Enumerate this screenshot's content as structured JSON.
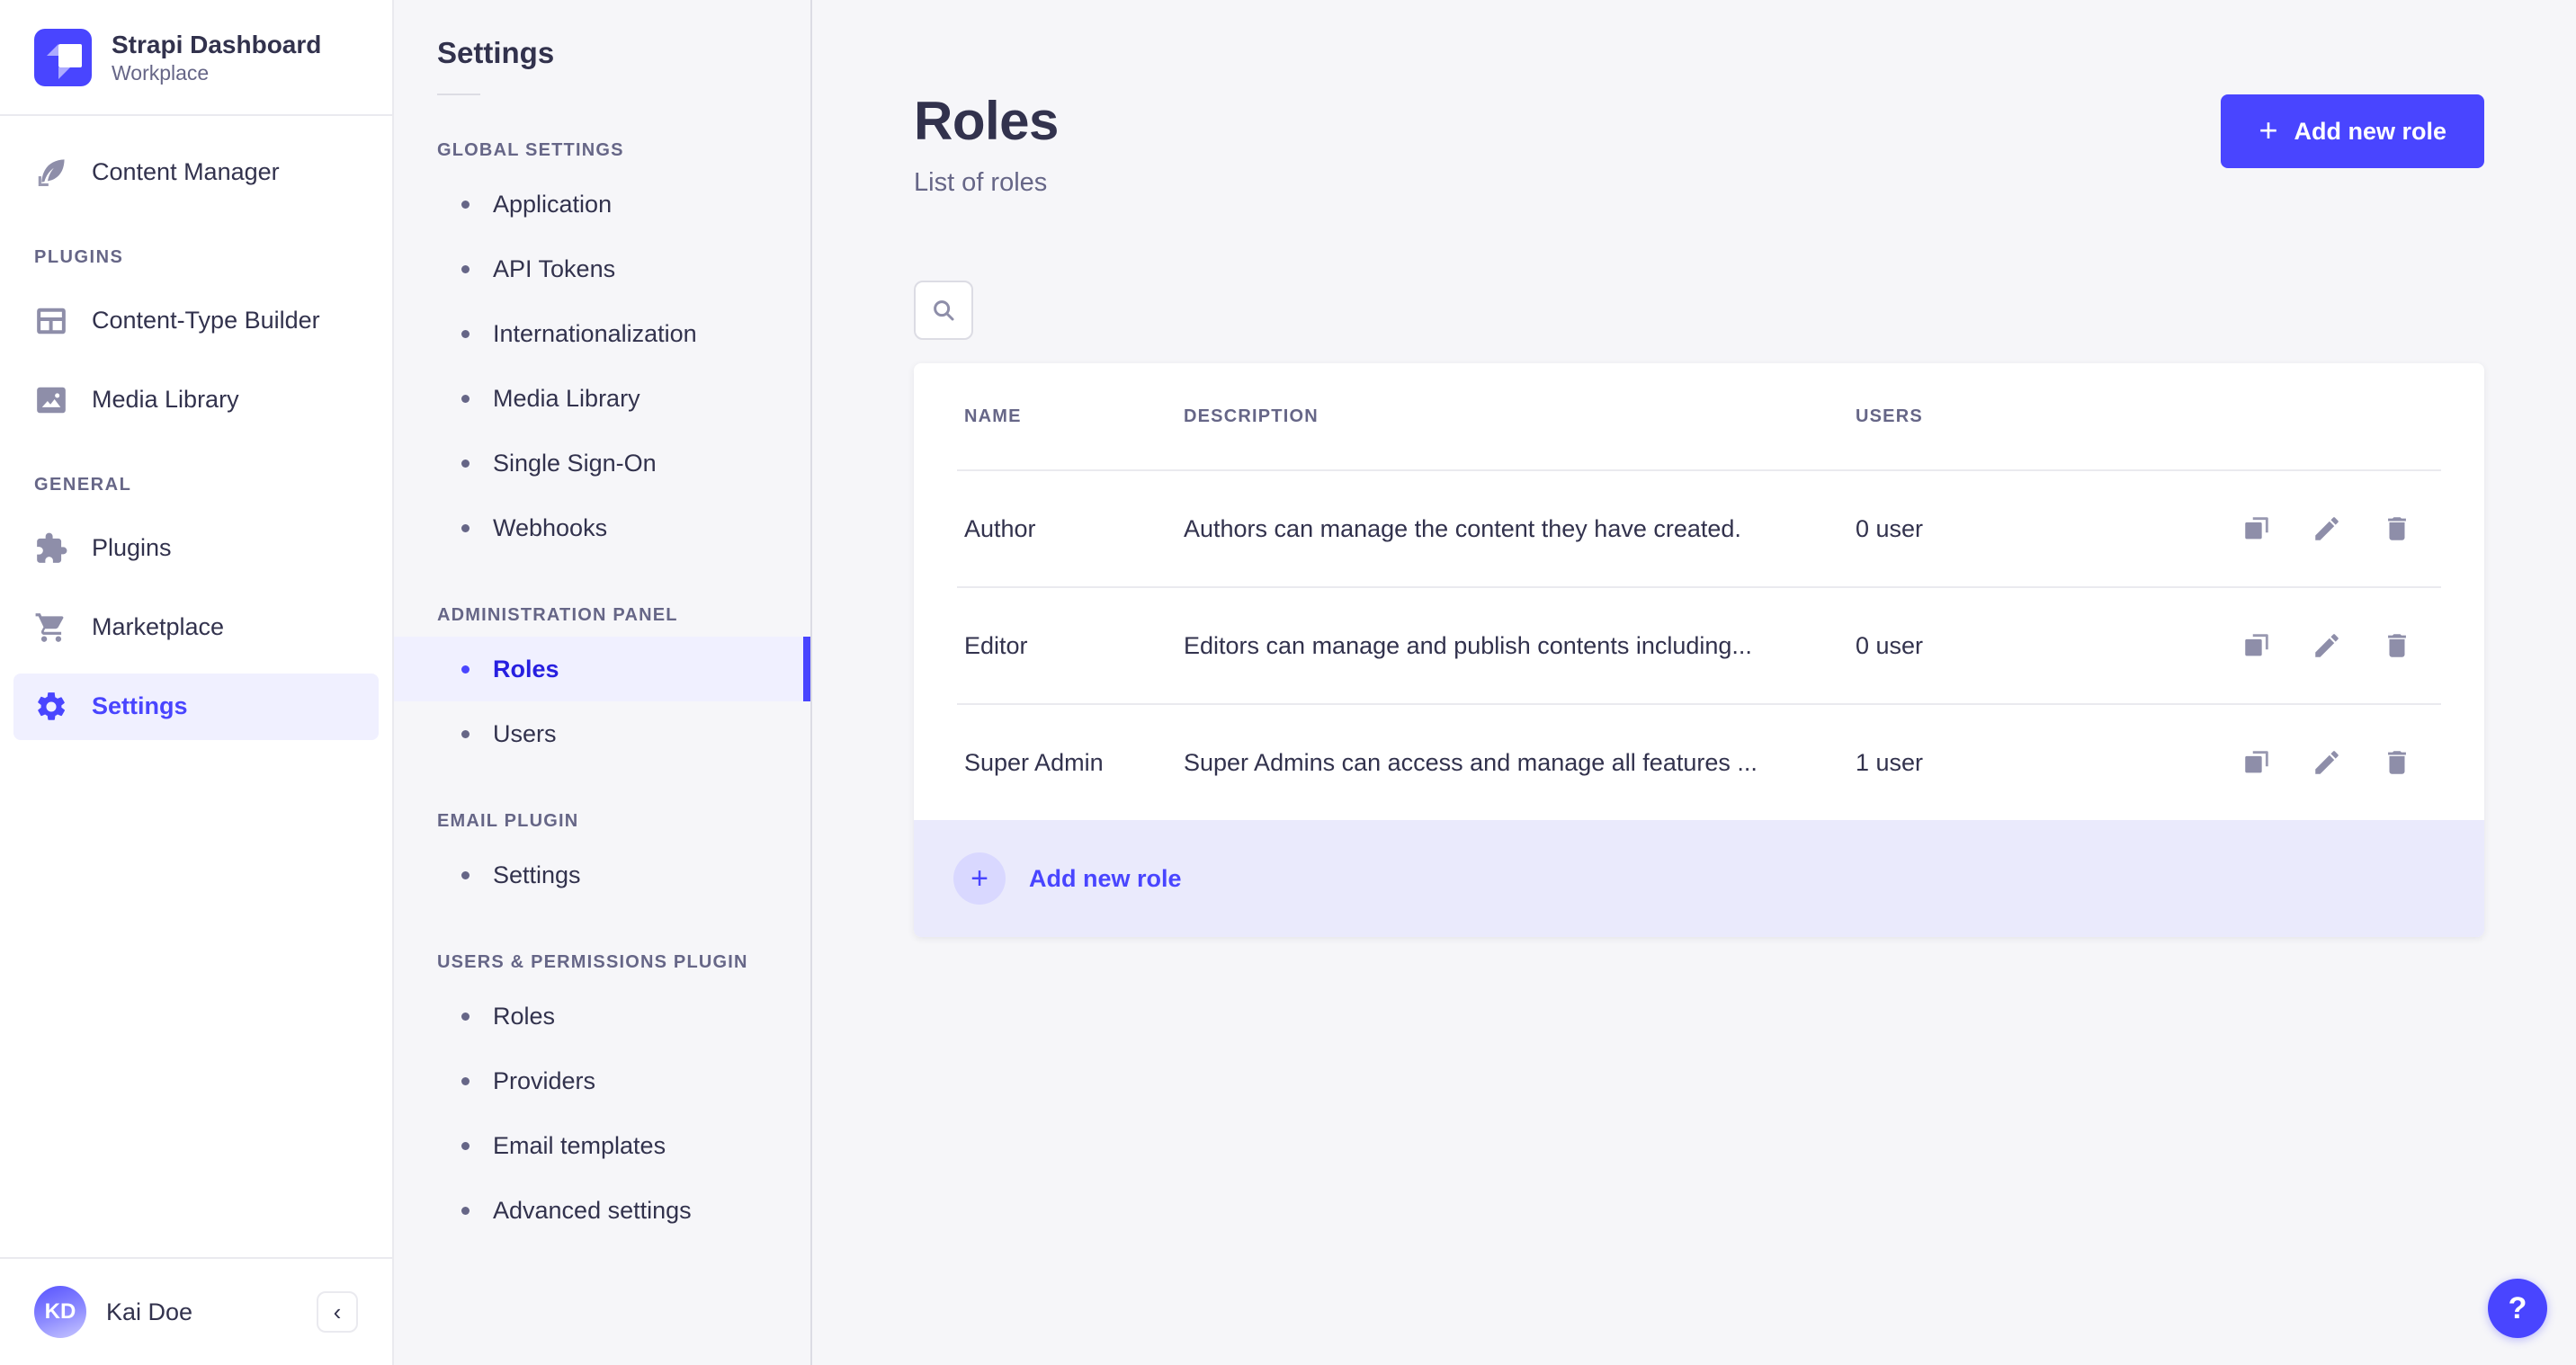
{
  "brand": {
    "title": "Strapi Dashboard",
    "subtitle": "Workplace"
  },
  "sidebar": {
    "content_manager": "Content Manager",
    "plugins_label": "PLUGINS",
    "plugins_items": [
      {
        "label": "Content-Type Builder",
        "icon": "layout-icon"
      },
      {
        "label": "Media Library",
        "icon": "image-icon"
      }
    ],
    "general_label": "GENERAL",
    "general_items": [
      {
        "label": "Plugins",
        "icon": "puzzle-icon"
      },
      {
        "label": "Marketplace",
        "icon": "cart-icon"
      },
      {
        "label": "Settings",
        "icon": "gear-icon"
      }
    ],
    "user": {
      "name": "Kai Doe",
      "initials": "KD"
    },
    "collapse": "‹"
  },
  "settings_nav": {
    "title": "Settings",
    "sections": [
      {
        "label": "GLOBAL SETTINGS",
        "items": [
          "Application",
          "API Tokens",
          "Internationalization",
          "Media Library",
          "Single Sign-On",
          "Webhooks"
        ]
      },
      {
        "label": "ADMINISTRATION PANEL",
        "items": [
          "Roles",
          "Users"
        ]
      },
      {
        "label": "EMAIL PLUGIN",
        "items": [
          "Settings"
        ]
      },
      {
        "label": "USERS & PERMISSIONS PLUGIN",
        "items": [
          "Roles",
          "Providers",
          "Email templates",
          "Advanced settings"
        ]
      }
    ],
    "active_item": "Roles"
  },
  "main": {
    "title": "Roles",
    "subtitle": "List of roles",
    "add_button_label": "Add new role",
    "add_button_plus": "+",
    "table": {
      "headers": {
        "name": "NAME",
        "description": "DESCRIPTION",
        "users": "USERS"
      },
      "rows": [
        {
          "name": "Author",
          "description": "Authors can manage the content they have created.",
          "users": "0 user"
        },
        {
          "name": "Editor",
          "description": "Editors can manage and publish contents including...",
          "users": "0 user"
        },
        {
          "name": "Super Admin",
          "description": "Super Admins can access and manage all features ...",
          "users": "1 user"
        }
      ],
      "footer_action": "Add new role",
      "footer_plus": "+"
    },
    "help_label": "?"
  },
  "colors": {
    "primary": "#4945ff",
    "primary_text_active": "#271fe0",
    "selected_bg": "#f0f0ff",
    "footer_row_bg": "#eaeafc",
    "text_dark": "#32324d",
    "text_muted": "#666687",
    "icon_muted": "#8e8ea9",
    "border": "#eaeaef",
    "page_bg": "#f6f6f9"
  }
}
